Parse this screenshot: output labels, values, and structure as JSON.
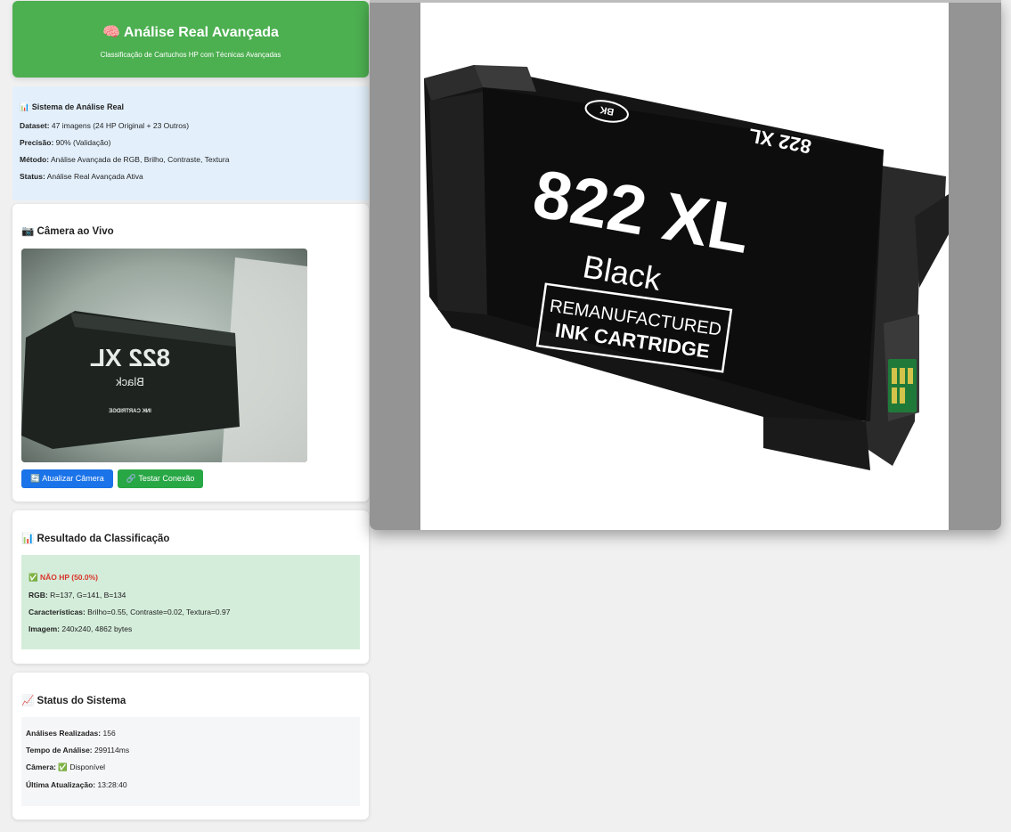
{
  "header": {
    "icon": "brain-icon",
    "title": "Análise Real Avançada",
    "subtitle": "Classificação de Cartuchos HP com Técnicas Avançadas"
  },
  "info": {
    "title": "Sistema de Análise Real",
    "dataset_label": "Dataset:",
    "dataset_value": "47 imagens (24 HP Original + 23 Outros)",
    "precision_label": "Precisão:",
    "precision_value": "90% (Validação)",
    "method_label": "Método:",
    "method_value": "Análise Avançada de RGB, Brilho, Contraste, Textura",
    "status_label": "Status:",
    "status_value": "Análise Real Avançada Ativa"
  },
  "camera": {
    "title": "Câmera ao Vivo",
    "feed_text_model": "822 XL",
    "feed_text_color": "Black",
    "feed_text_small": "INK CARTRIDGE",
    "refresh_label": "Atualizar Câmera",
    "test_label": "Testar Conexão"
  },
  "result": {
    "title": "Resultado da Classificação",
    "verdict": "NÃO HP (50.0%)",
    "rgb_label": "RGB:",
    "rgb_value": "R=137, G=141, B=134",
    "features_label": "Características:",
    "features_value": "Brilho=0.55, Contraste=0.02, Textura=0.97",
    "image_label": "Imagem:",
    "image_value": "240x240, 4862 bytes"
  },
  "status": {
    "title": "Status do Sistema",
    "analyses_label": "Análises Realizadas:",
    "analyses_value": "156",
    "time_label": "Tempo de Análise:",
    "time_value": "299114ms",
    "camera_label": "Câmera:",
    "camera_value": "Disponível",
    "updated_label": "Última Atualização:",
    "updated_value": "13:28:40"
  },
  "viewer": {
    "bk_badge": "BK",
    "model": "822 XL",
    "model_top_rotated": "822 XL",
    "color": "Black",
    "line1": "REMANUFACTURED",
    "line2": "INK CARTRIDGE"
  },
  "colors": {
    "header": "#4caf50",
    "info_bg": "#e3f0fc",
    "button_blue": "#1a73e8",
    "button_green": "#28a745",
    "result_bg": "#d4edda",
    "nohp": "#d9342b"
  }
}
